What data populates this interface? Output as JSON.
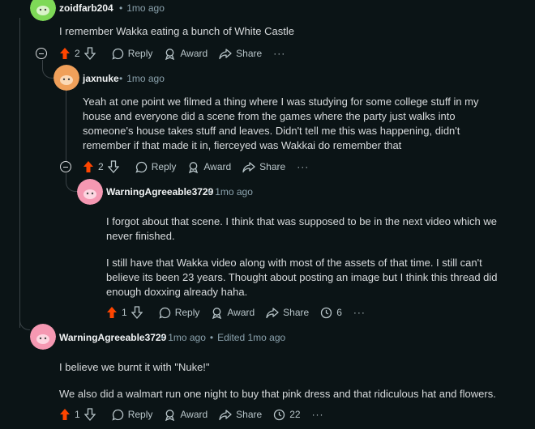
{
  "comments": [
    {
      "username": "zoidfarb204",
      "time": "1mo ago",
      "paragraphs": [
        "I remember Wakka eating a bunch of White Castle"
      ],
      "votes": "2",
      "upvoted": true,
      "reply_label": "Reply",
      "award_label": "Award",
      "share_label": "Share",
      "more_label": "···",
      "avatar_color": "#7ed957"
    },
    {
      "username": "jaxnuke",
      "time": "1mo ago",
      "paragraphs": [
        "Yeah at one point we filmed a thing where I was studying for some college stuff in my house and everyone did a scene from the games where the party just walks into someone's house takes stuff and leaves. Didn't tell me this was happening, didn't remember if that made it in, fierceyed was Wakkai do remember that"
      ],
      "votes": "2",
      "upvoted": true,
      "reply_label": "Reply",
      "award_label": "Award",
      "share_label": "Share",
      "more_label": "···",
      "avatar_color": "#f0a05a"
    },
    {
      "username": "WarningAgreeable3729",
      "time": "1mo ago",
      "paragraphs": [
        "I forgot about that scene. I think that was supposed to be in the next video which we never finished.",
        "I still have that Wakka video along with most of the assets of that time. I still can't believe its been 23 years. Thought about posting an image but I think this thread did enough doxxing already haha."
      ],
      "votes": "1",
      "upvoted": true,
      "reply_label": "Reply",
      "award_label": "Award",
      "share_label": "Share",
      "replies_count": "6",
      "more_label": "···",
      "avatar_color": "#f598b2"
    },
    {
      "username": "WarningAgreeable3729",
      "time": "1mo ago",
      "edited": "Edited 1mo ago",
      "paragraphs": [
        "I believe we burnt it with \"Nuke!\"",
        "We also did a walmart run one night to buy that pink dress and that ridiculous hat and flowers."
      ],
      "votes": "1",
      "upvoted": true,
      "reply_label": "Reply",
      "award_label": "Award",
      "share_label": "Share",
      "replies_count": "22",
      "more_label": "···",
      "avatar_color": "#f598b2"
    }
  ],
  "colors": {
    "background": "#0b1416",
    "upvote": "#ff4500",
    "text": "#d7dadc",
    "muted": "#8ba2ad",
    "thread_line": "#3a4246"
  }
}
